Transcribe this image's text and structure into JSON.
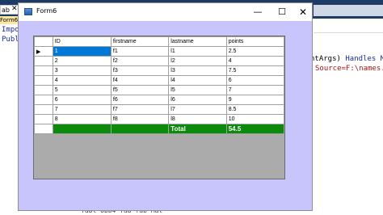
{
  "ide": {
    "tab_left": "ab",
    "file_tab": "Form6",
    "gutter_lines": [
      "Impo",
      "Publ"
    ],
    "code_right_1a": "ntArgs) ",
    "code_right_1b": "Handles My",
    "code_right_2": "Source=F:\\names.",
    "bottom_code": "        Tabl Ubb4   Tab  Tab Mat"
  },
  "window": {
    "title": "Form6",
    "minimize_glyph": "—",
    "maximize_glyph": "☐",
    "close_glyph": "✕"
  },
  "grid": {
    "columns": [
      "ID",
      "firstname",
      "lastname",
      "points"
    ],
    "current_row_marker": "▶",
    "rows": [
      {
        "id": "1",
        "firstname": "f1",
        "lastname": "l1",
        "points": "2.5"
      },
      {
        "id": "2",
        "firstname": "f2",
        "lastname": "l2",
        "points": "4"
      },
      {
        "id": "3",
        "firstname": "f3",
        "lastname": "l3",
        "points": "7.5"
      },
      {
        "id": "4",
        "firstname": "f4",
        "lastname": "l4",
        "points": "6"
      },
      {
        "id": "5",
        "firstname": "f5",
        "lastname": "l5",
        "points": "7"
      },
      {
        "id": "6",
        "firstname": "f6",
        "lastname": "l6",
        "points": "9"
      },
      {
        "id": "7",
        "firstname": "f7",
        "lastname": "l7",
        "points": "8.5"
      },
      {
        "id": "8",
        "firstname": "f8",
        "lastname": "l8",
        "points": "10"
      }
    ],
    "total_label": "Total",
    "total_value": "54.5",
    "colors": {
      "selection": "#0078d7",
      "total_row": "#0b8a0b",
      "form_background": "#c7c5fb",
      "grid_background": "#ababab"
    }
  }
}
